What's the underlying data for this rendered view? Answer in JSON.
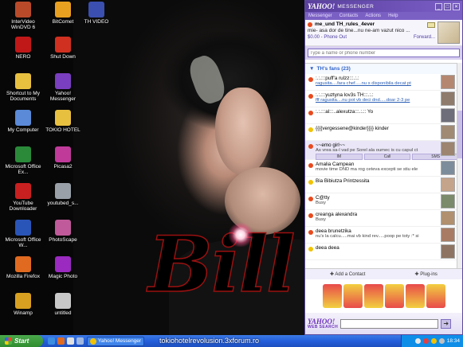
{
  "desktop": {
    "icons": [
      {
        "label": "InterVideo WinDVD 6",
        "icon": "windvd-icon",
        "color": "#b84a2a"
      },
      {
        "label": "BitComet",
        "icon": "bitcomet-icon",
        "color": "#e8a020"
      },
      {
        "label": "TH VIDEO",
        "icon": "video-file-icon",
        "color": "#3b4fb0"
      },
      {
        "label": "NERO",
        "icon": "nero-icon",
        "color": "#c01818"
      },
      {
        "label": "Shut Down",
        "icon": "shutdown-icon",
        "color": "#d03020"
      },
      {
        "label": "Shortcut to My Documents",
        "icon": "folder-icon",
        "color": "#e8c040"
      },
      {
        "label": "Yahoo! Messenger",
        "icon": "yahoo-messenger-icon",
        "color": "#7a3ec0"
      },
      {
        "label": "My Computer",
        "icon": "computer-icon",
        "color": "#5a8ad8"
      },
      {
        "label": "TOKIO HOTEL",
        "icon": "folder-icon",
        "color": "#e8c040"
      },
      {
        "label": "Microsoft Office Ex...",
        "icon": "excel-icon",
        "color": "#2a8a3a"
      },
      {
        "label": "Picasa2",
        "icon": "picasa-icon",
        "color": "#c03a9a"
      },
      {
        "label": "YouTube Downloader",
        "icon": "youtube-downloader-icon",
        "color": "#c82020"
      },
      {
        "label": "youtubed_s...",
        "icon": "document-icon",
        "color": "#9aa0a8"
      },
      {
        "label": "Microsoft Office W...",
        "icon": "word-icon",
        "color": "#2a55b8"
      },
      {
        "label": "PhotoScape",
        "icon": "photoscape-icon",
        "color": "#c05a9a"
      },
      {
        "label": "Mozilla Firefox",
        "icon": "firefox-icon",
        "color": "#e06a20"
      },
      {
        "label": "Magic Photo",
        "icon": "magic-photo-icon",
        "color": "#9a2ac0"
      },
      {
        "label": "Winamp",
        "icon": "winamp-icon",
        "color": "#d8a020"
      },
      {
        "label": "untitled",
        "icon": "document-icon",
        "color": "#c8c8c8"
      }
    ],
    "wallpaper_text": "Bill"
  },
  "messenger": {
    "logo": "YAHOO!",
    "title": "MESSENGER",
    "menu": [
      "Messenger",
      "Contacts",
      "Actions",
      "Help"
    ],
    "profile": {
      "name": "me_und TH_rules_4ever",
      "status": "mie- asa dor de tine...nu ne-am vazut nico ...",
      "balance": "$0.00 - Phone Out",
      "forward": "Forward..."
    },
    "search_placeholder": "Type a name or phone number",
    "group": "TH's fans (23)",
    "contacts": [
      {
        "name": ":.:.:::puff'a rulzz:::.:.:",
        "status": "ragusita....fara chef.....nu s disponibila decat pt",
        "status_link": true,
        "dot": "#e8491d"
      },
      {
        "name": ":.:.:::yuztyna lov3s TH:::.:.:",
        "status": "fff ragusita....nu pot vb deci dnd.....doar 2-3 pe",
        "status_link": true,
        "dot": "#e8491d"
      },
      {
        "name": ":.:.:::al:::..alexutza:::.:.:: Yo",
        "status": "",
        "status_link": false,
        "dot": "#e8491d"
      },
      {
        "name": "{{{{vergessene@kinder}}}} kinder",
        "status": "",
        "status_link": false,
        "dot": "#f2c200"
      },
      {
        "name": "~~emo girl~~",
        "status": "As vrea sa-l vad pe Sorel ala oumec is cu capul ct",
        "status_link": false,
        "dot": "#e8491d",
        "selected": true,
        "tabs": [
          "IM",
          "Call",
          "SMS"
        ]
      },
      {
        "name": "Amalia Campean",
        "status": "movie time DND ma rog ceteva excepti se stiu ele",
        "status_link": false,
        "dot": "#e8491d"
      },
      {
        "name": "Bia Bibiutza Printzessita",
        "status": "",
        "status_link": false,
        "dot": "#f2c200"
      },
      {
        "name": "C@tty",
        "status": "Busy",
        "status_link": false,
        "dot": "#e8491d"
      },
      {
        "name": "creanga alexandra",
        "status": "Busy",
        "status_link": false,
        "dot": "#e8491d"
      },
      {
        "name": "deea brunetzika",
        "status": "nu's la calcu.....mai vb kind rev.....poop pe toty :* si",
        "status_link": false,
        "dot": "#e8491d"
      },
      {
        "name": "deea deea",
        "status": "",
        "status_link": false,
        "dot": "#f2c200"
      }
    ],
    "bottom": {
      "add_contact": "Add a Contact",
      "plugins": "Plug-ins"
    },
    "websearch": {
      "logo": "YAHOO!",
      "label": "WEB SEARCH"
    }
  },
  "taskbar": {
    "start": "Start",
    "task": "Yahoo! Messenger",
    "watermark": "tokiohotelrevolusion.3xforum.ro",
    "clock": "18:34"
  }
}
